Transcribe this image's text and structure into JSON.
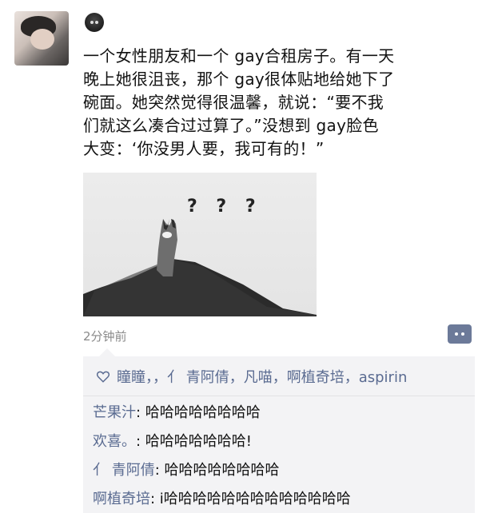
{
  "post": {
    "text_lines": [
      "一个女性朋友和一个 gay合租房子。有一天",
      "晚上她很沮丧，那个 gay很体贴地给她下了",
      "碗面。她突然觉得很温馨，就说：“要不我",
      "们就这么凑合过过算了。”没想到 gay脸色",
      "大变：‘你没男人要，我可有的！”"
    ],
    "image_caption": "? ? ?",
    "timestamp": "2分钟前"
  },
  "likes": {
    "names": "瞳瞳，，亻 青阿倩，凡喵，啊植奇培，aspirin"
  },
  "comments": [
    {
      "name": "芒果汁",
      "text": "哈哈哈哈哈哈哈哈"
    },
    {
      "name": "欢喜。",
      "text": "哈哈哈哈哈哈哈!"
    },
    {
      "name": "亻 青阿倩",
      "text": "哈哈哈哈哈哈哈哈"
    },
    {
      "name": "啊植奇培",
      "text": "i哈哈哈哈哈哈哈哈哈哈哈哈哈"
    }
  ],
  "colors": {
    "name_link": "#5a6b91",
    "comment_button": "#6c7a99",
    "interaction_bg": "#f3f3f5"
  },
  "icons": {
    "avatar": "avatar",
    "username": "user-badge-icon",
    "comment_button": "comment-dots-icon",
    "like": "heart-outline-icon"
  }
}
